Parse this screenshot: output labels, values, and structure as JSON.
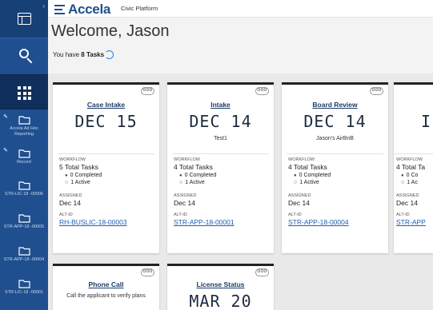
{
  "sidebar": {
    "items": [
      {
        "label": "Accela Ad Hoc Reporting"
      },
      {
        "label": "Record"
      },
      {
        "label": "STR-LIC-18 -00006"
      },
      {
        "label": "STR-APP-18 -00005"
      },
      {
        "label": "STR-APP-18 -00004"
      },
      {
        "label": "STR-LIC-18 -00001"
      }
    ]
  },
  "header": {
    "brand": "Accela",
    "platform": "Civic Platform"
  },
  "welcome": {
    "title": "Welcome, Jason",
    "tasks_prefix": "You have ",
    "tasks_count": "8 Tasks"
  },
  "cards": [
    {
      "title": "Case Intake",
      "date": "DEC 15",
      "subtitle": "",
      "workflow_label": "WORKFLOW",
      "total": "5 Total Tasks",
      "completed": "0 Completed",
      "active": "1 Active",
      "assigned_label": "ASSIGNED",
      "assigned": "Dec 14",
      "altid_label": "ALT-ID",
      "altid": "RH-BUSLIC-18-00003"
    },
    {
      "title": "Intake",
      "date": "DEC 14",
      "subtitle": "Test1",
      "workflow_label": "WORKFLOW",
      "total": "4 Total Tasks",
      "completed": "0 Completed",
      "active": "1 Active",
      "assigned_label": "ASSIGNED",
      "assigned": "Dec 14",
      "altid_label": "ALT-ID",
      "altid": "STR-APP-18-00001"
    },
    {
      "title": "Board Review",
      "date": "DEC 14",
      "subtitle": "Jason's AirBnB",
      "workflow_label": "WORKFLOW",
      "total": "4 Total Tasks",
      "completed": "0 Completed",
      "active": "1 Active",
      "assigned_label": "ASSIGNED",
      "assigned": "Dec 14",
      "altid_label": "ALT-ID",
      "altid": "STR-APP-18-00004"
    },
    {
      "title": "",
      "date": "I",
      "subtitle": "",
      "workflow_label": "WORKFLOW",
      "total": "4 Total Ta",
      "completed": "0 Co",
      "active": "1 Ac",
      "assigned_label": "ASSIGNED",
      "assigned": "Dec 14",
      "altid_label": "ALT-ID",
      "altid": "STR-APP"
    },
    {
      "title": "Phone Call",
      "description": "Call the applicant to verify plans"
    },
    {
      "title": "License Status",
      "date": "MAR 20"
    }
  ]
}
